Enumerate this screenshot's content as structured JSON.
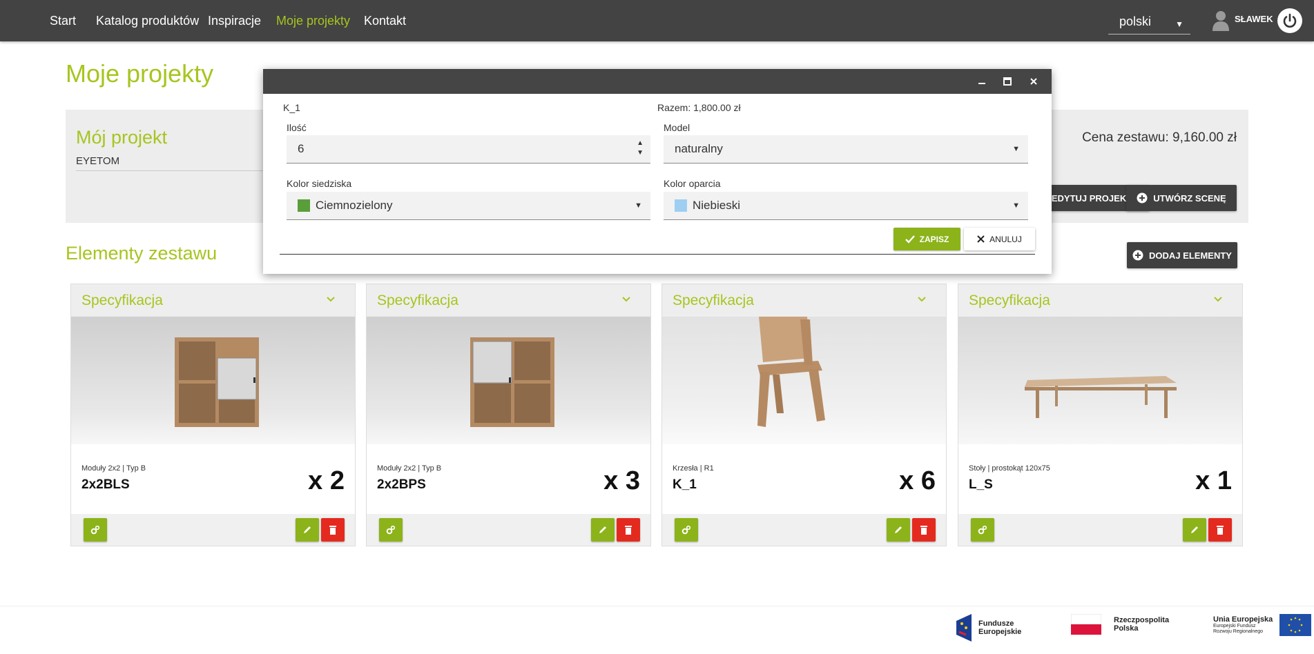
{
  "nav": {
    "items": [
      {
        "label": "Start",
        "active": false
      },
      {
        "label": "Katalog produktów",
        "active": false
      },
      {
        "label": "Inspiracje",
        "active": false
      },
      {
        "label": "Moje projekty",
        "active": true
      },
      {
        "label": "Kontakt",
        "active": false
      }
    ],
    "language": "polski",
    "user": "SŁAWEK"
  },
  "page": {
    "title": "Moje projekty"
  },
  "project": {
    "name": "Mój projekt",
    "description": "EYETOM",
    "price": "Cena zestawu: 9,160.00 zł",
    "edit_button": "EDYTUJ PROJEKT",
    "create_scene_button": "UTWÓRZ SCENĘ"
  },
  "elements": {
    "title": "Elementy zestawu",
    "add_button": "DODAJ ELEMENTY",
    "cards": [
      {
        "header": "Specyfikacja",
        "category": "Moduły 2x2 | Typ B",
        "name": "2x2BLS",
        "qty": "x 2"
      },
      {
        "header": "Specyfikacja",
        "category": "Moduły 2x2 | Typ B",
        "name": "2x2BPS",
        "qty": "x 3"
      },
      {
        "header": "Specyfikacja",
        "category": "Krzesła | R1",
        "name": "K_1",
        "qty": "x 6"
      },
      {
        "header": "Specyfikacja",
        "category": "Stoły | prostokąt 120x75",
        "name": "L_S",
        "qty": "x 1"
      }
    ]
  },
  "modal": {
    "item_name": "K_1",
    "total": "Razem: 1,800.00 zł",
    "quantity_label": "Ilość",
    "quantity_value": "6",
    "model_label": "Model",
    "model_value": "naturalny",
    "seat_color_label": "Kolor siedziska",
    "seat_color_value": "Ciemnozielony",
    "seat_color_hex": "#5a9e3a",
    "back_color_label": "Kolor oparcia",
    "back_color_value": "Niebieski",
    "back_color_hex": "#9ecff2",
    "save_button": "ZAPISZ",
    "cancel_button": "ANULUJ"
  },
  "footer": {
    "logos": [
      {
        "line1": "Fundusze",
        "line2": "Europejskie"
      },
      {
        "line1": "Rzeczpospolita",
        "line2": "Polska"
      },
      {
        "line1": "Unia Europejska",
        "line2": "Europejski Fundusz",
        "line3": "Rozwoju Regionalnego"
      }
    ]
  },
  "colors": {
    "accent": "#a6c51f",
    "nav_bg": "#434343",
    "delete": "#e42a1f"
  }
}
